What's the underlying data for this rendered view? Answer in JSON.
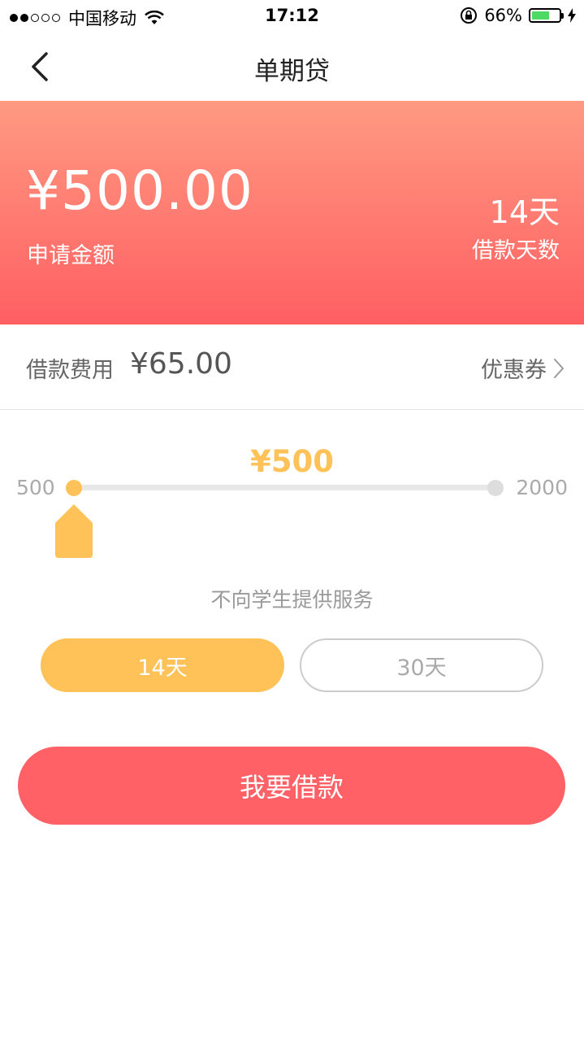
{
  "status_bar": {
    "carrier": "中国移动",
    "time": "17:12",
    "battery_percent": "66%",
    "battery_level": 0.66,
    "signal_bars": 2,
    "signal_total": 5
  },
  "nav": {
    "title": "单期贷"
  },
  "hero": {
    "amount": "¥500.00",
    "amount_label": "申请金额",
    "days": "14天",
    "days_label": "借款天数"
  },
  "fee": {
    "label": "借款费用",
    "value": "¥65.00",
    "coupon_label": "优惠券"
  },
  "slider": {
    "current_label": "¥500",
    "min_label": "500",
    "max_label": "2000",
    "min": 500,
    "max": 2000,
    "value": 500
  },
  "notice": "不向学生提供服务",
  "terms": {
    "option_14": "14天",
    "option_30": "30天",
    "selected": "14天"
  },
  "submit_label": "我要借款",
  "colors": {
    "accent_yellow": "#ffc258",
    "accent_red": "#ff6166",
    "hero_top": "#ff9a82",
    "hero_bottom": "#ff5f62"
  }
}
